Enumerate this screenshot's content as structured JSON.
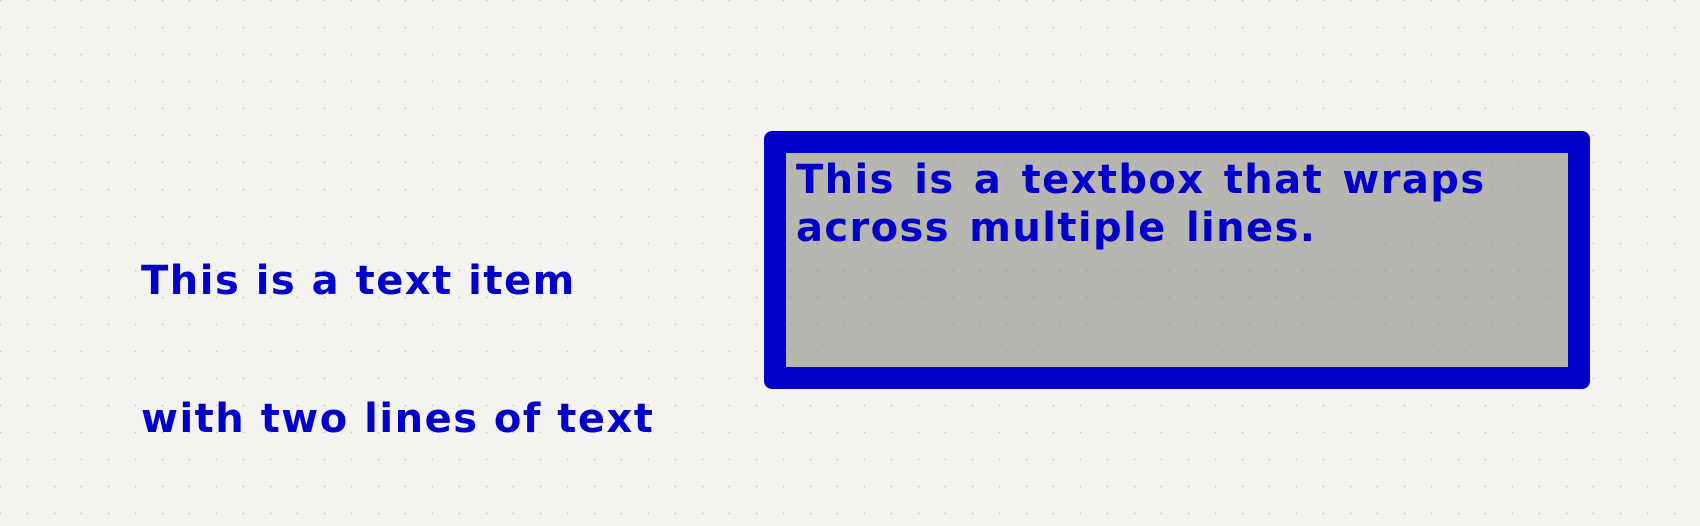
{
  "schematic": {
    "text_item": {
      "lines": [
        "This is a text item",
        "with two lines of text"
      ]
    },
    "textbox": {
      "text": "This is a textbox that wraps across multiple lines."
    }
  },
  "colors": {
    "canvas_background": "#f4f3ef",
    "grid_dot": "#cfcdc4",
    "text": "#0000c8",
    "textbox_border": "#0000c8",
    "textbox_fill": "#b8b6b1"
  }
}
